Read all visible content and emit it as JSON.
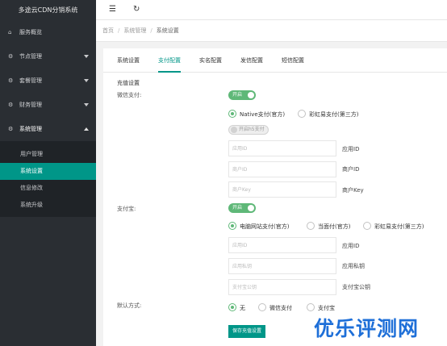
{
  "sidebar": {
    "brand": "多途云CDN分销系统",
    "items": [
      {
        "label": "服务概览",
        "icon": "home-icon"
      },
      {
        "label": "节点管理",
        "icon": "gear-icon"
      },
      {
        "label": "套餐管理",
        "icon": "gear-icon"
      },
      {
        "label": "财务管理",
        "icon": "gear-icon"
      },
      {
        "label": "系统管理",
        "icon": "gear-icon"
      }
    ],
    "subitems": [
      {
        "label": "用户管理"
      },
      {
        "label": "系统设置"
      },
      {
        "label": "信息修改"
      },
      {
        "label": "系统升级"
      }
    ]
  },
  "topbar": {
    "menu_icon": "☰",
    "refresh_icon": "↻"
  },
  "breadcrumb": {
    "home": "首页",
    "section": "系统管理",
    "current": "系统设置",
    "sep": "/"
  },
  "tabs": [
    "系统设置",
    "支付配置",
    "实名配置",
    "发信配置",
    "短信配置"
  ],
  "form": {
    "section_title": "充值设置",
    "wechat": {
      "label": "微信支付:",
      "switch_label": "开启",
      "radio_native": "Native支付(官方)",
      "radio_third": "彩虹易支付(第三方)",
      "h5_switch_label": "开启h5支付",
      "appid_placeholder": "应用ID",
      "appid_label": "应用ID",
      "mchid_placeholder": "商户ID",
      "mchid_label": "商户ID",
      "key_placeholder": "商户Key",
      "key_label": "商户Key"
    },
    "alipay": {
      "label": "支付宝:",
      "switch_label": "开启",
      "radio_web": "电脑网站支付(官方)",
      "radio_face": "当面付(官方)",
      "radio_third": "彩虹易支付(第三方)",
      "appid_placeholder": "应用ID",
      "appid_label": "应用ID",
      "privkey_placeholder": "应用私钥",
      "privkey_label": "应用私钥",
      "pubkey_placeholder": "支付宝公钥",
      "pubkey_label": "支付宝公钥"
    },
    "default_method": {
      "label": "默认方式:",
      "opt_none": "无",
      "opt_wechat": "微信支付",
      "opt_alipay": "支付宝"
    },
    "save_button": "保存充值设置"
  },
  "watermark": "优乐评测网",
  "colors": {
    "accent": "#009688",
    "switch_on": "#5fb878",
    "sidebar_bg": "#2a2e33",
    "watermark": "#1e6fd8"
  }
}
